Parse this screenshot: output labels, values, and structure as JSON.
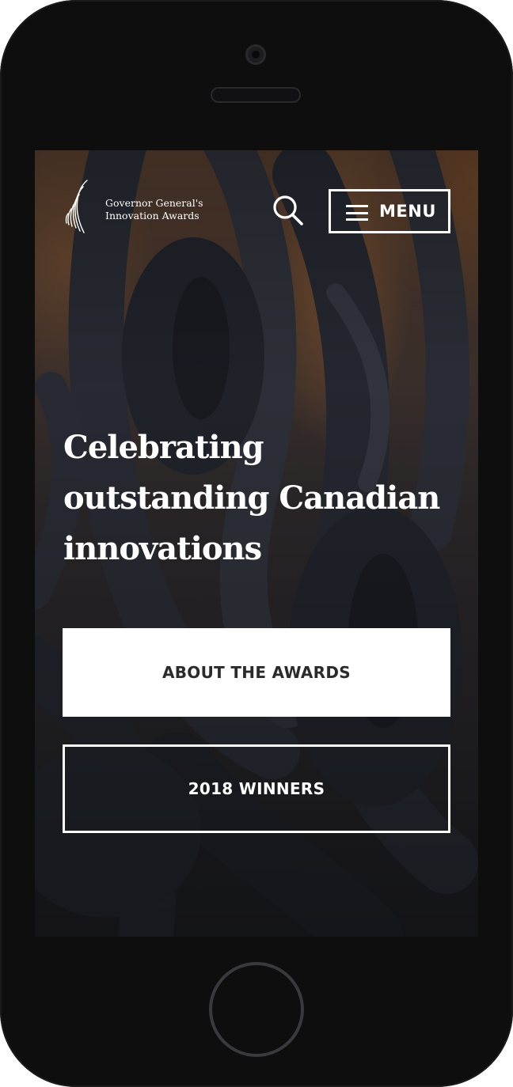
{
  "colors": {
    "device_frame": "#0e0e0e",
    "text_light": "#ffffff",
    "primary_button_bg": "#ffffff",
    "primary_button_text": "#2b2b2b"
  },
  "header": {
    "logo": {
      "line1": "Governor General's",
      "line2": "Innovation Awards"
    },
    "search_icon": "search-icon",
    "menu": {
      "icon": "hamburger-icon",
      "label": "MENU"
    }
  },
  "hero": {
    "title": "Celebrating outstanding Canadian innovations",
    "buttons": {
      "about": "ABOUT THE AWARDS",
      "winners": "2018 WINNERS"
    }
  }
}
